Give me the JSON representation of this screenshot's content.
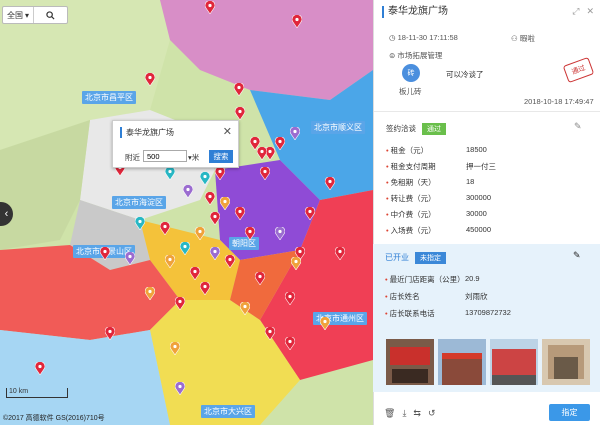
{
  "map": {
    "region_select": "全国",
    "districts": [
      "北京市昌平区",
      "北京市顺义区",
      "北京市海淀区",
      "北京市石景山区",
      "朝阳区",
      "北京市通州区",
      "北京市大兴区"
    ],
    "popup": {
      "title": "泰华龙旗广场",
      "near_label": "附近",
      "radius": "500",
      "unit": "米",
      "search_button": "搜索"
    },
    "scale": "10 km",
    "copyright": "©2017 高德软件 GS(2016)710号"
  },
  "panel": {
    "title": "泰华龙旗广场",
    "log": {
      "time": "18-11-30 17:11:58",
      "user": "暇啦",
      "dept": "市场拓展管理",
      "avatar_text": "砖",
      "avatar_name": "板儿砖",
      "comment": "可以冷谈了",
      "stamp": "通过",
      "comment_time": "2018-10-18 17:49:47"
    },
    "status_label": "签约洽谈",
    "status_badge": "通过",
    "fields": [
      {
        "k": "租金（元）",
        "v": "18500"
      },
      {
        "k": "租金支付周期",
        "v": "押一付三"
      },
      {
        "k": "免租期（天）",
        "v": "18"
      },
      {
        "k": "转让费（元）",
        "v": "300000"
      },
      {
        "k": "中介费（元）",
        "v": "30000"
      },
      {
        "k": "入场费（元）",
        "v": "450000"
      }
    ],
    "open": {
      "label": "已开业",
      "badge": "未指定"
    },
    "open_fields": [
      {
        "k": "最近门店距离（公里）",
        "v": "20.9"
      },
      {
        "k": "店长姓名",
        "v": "刘雨欣"
      },
      {
        "k": "店长联系电话",
        "v": "13709872732"
      }
    ],
    "confirm_button": "指定"
  },
  "colors": {
    "accent": "#2f7fd5",
    "pin": "#e0263b",
    "pin_purple": "#9b6cd0",
    "pin_orange": "#f0a23a",
    "pin_teal": "#28b7c4"
  }
}
